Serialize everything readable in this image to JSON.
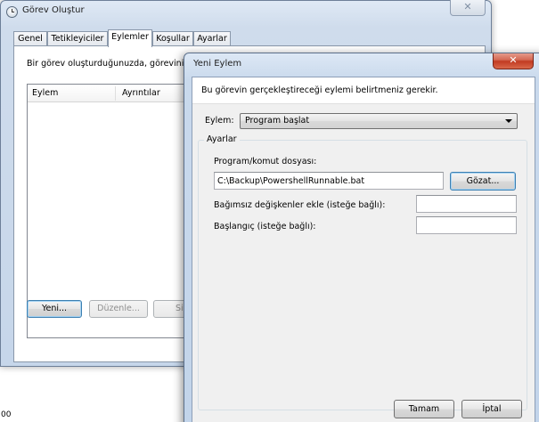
{
  "back_window": {
    "title": "Görev Oluştur",
    "close_glyph": "✕",
    "tabs": [
      "Genel",
      "Tetikleyiciler",
      "Eylemler",
      "Koşullar",
      "Ayarlar"
    ],
    "active_tab": "Eylemler",
    "description": "Bir görev oluşturduğunuzda, göreviniz b",
    "list": {
      "columns": [
        "Eylem",
        "Ayrıntılar"
      ],
      "rows": []
    },
    "buttons": {
      "new": "Yeni...",
      "edit": "Düzenle...",
      "delete": "Sil"
    },
    "status_fragment": "00"
  },
  "dialog": {
    "title": "Yeni Eylem",
    "close_glyph": "✕",
    "description": "Bu görevin gerçekleştireceği eylemi belirtmeniz gerekir.",
    "action_label": "Eylem:",
    "action_value": "Program başlat",
    "settings_group": "Ayarlar",
    "program_label": "Program/komut dosyası:",
    "program_value": "C:\\Backup\\PowershellRunnable.bat",
    "browse_button": "Gözat...",
    "arguments_label": "Bağımsız değişkenler ekle (isteğe bağlı):",
    "arguments_value": "",
    "start_in_label": "Başlangıç (isteğe bağlı):",
    "start_in_value": "",
    "ok_button": "Tamam",
    "cancel_button": "İptal"
  }
}
